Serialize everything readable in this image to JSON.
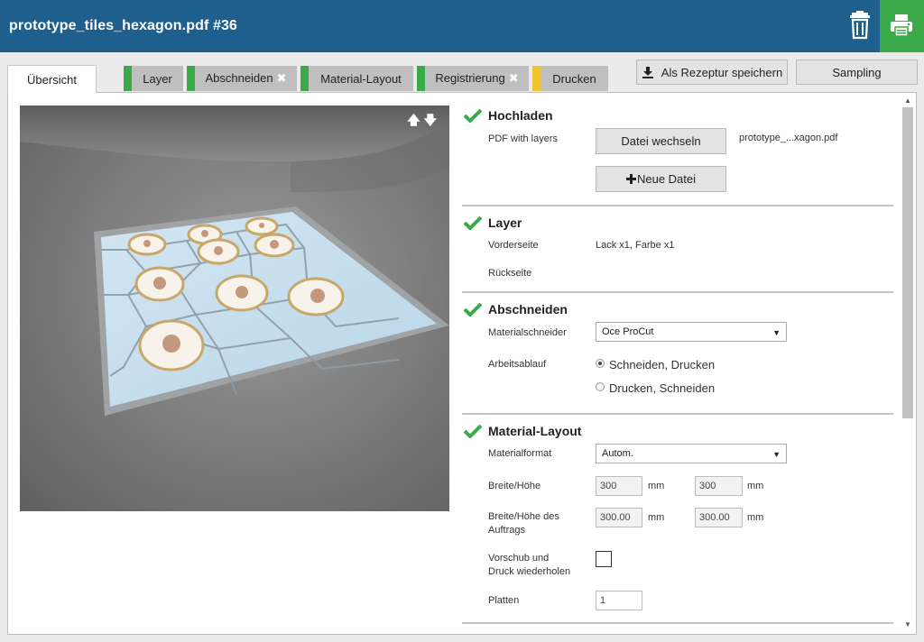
{
  "header": {
    "title": "prototype_tiles_hexagon.pdf #36"
  },
  "tabs": [
    {
      "label": "Übersicht",
      "status": "active"
    },
    {
      "label": "Layer",
      "status": "#3aab48"
    },
    {
      "label": "Abschneiden",
      "status": "#3aab48",
      "disabled_mark": "✖"
    },
    {
      "label": "Material-Layout",
      "status": "#3aab48"
    },
    {
      "label": "Registrierung",
      "status": "#3aab48",
      "disabled_mark": "✖"
    },
    {
      "label": "Drucken",
      "status": "#f2c230"
    }
  ],
  "toolbar": {
    "save_recipe": "Als Rezeptur speichern",
    "sampling": "Sampling"
  },
  "preview": {
    "arrows": "🡅🡇"
  },
  "sections": {
    "upload": {
      "title": "Hochladen",
      "label": "PDF with layers",
      "change_file": "Datei wechseln",
      "new_file": "Neue Datei",
      "filename": "prototype_...xagon.pdf"
    },
    "layer": {
      "title": "Layer",
      "front_label": "Vorderseite",
      "front_value": "Lack x1, Farbe x1",
      "back_label": "Rückseite"
    },
    "cut": {
      "title": "Abschneiden",
      "cutter_label": "Materialschneider",
      "cutter_value": "Oce ProCut",
      "workflow_label": "Arbeitsablauf",
      "workflow_options": [
        "Schneiden, Drucken",
        "Drucken, Schneiden"
      ],
      "workflow_selected": 0
    },
    "layout": {
      "title": "Material-Layout",
      "format_label": "Materialformat",
      "format_value": "Autom.",
      "size_label": "Breite/Höhe",
      "width": "300",
      "height": "300",
      "unit": "mm",
      "job_size_label_1": "Breite/Höhe des",
      "job_size_label_2": "Auftrags",
      "job_width": "300.00",
      "job_height": "300.00",
      "repeat_label_1": "Vorschub und",
      "repeat_label_2": "Druck wiederholen",
      "repeat_checked": false,
      "plates_label": "Platten",
      "plates_value": "1"
    }
  },
  "colors": {
    "header": "#1f5f8e",
    "print": "#3aab48",
    "ok": "#3aab48",
    "warn": "#f2c230"
  }
}
